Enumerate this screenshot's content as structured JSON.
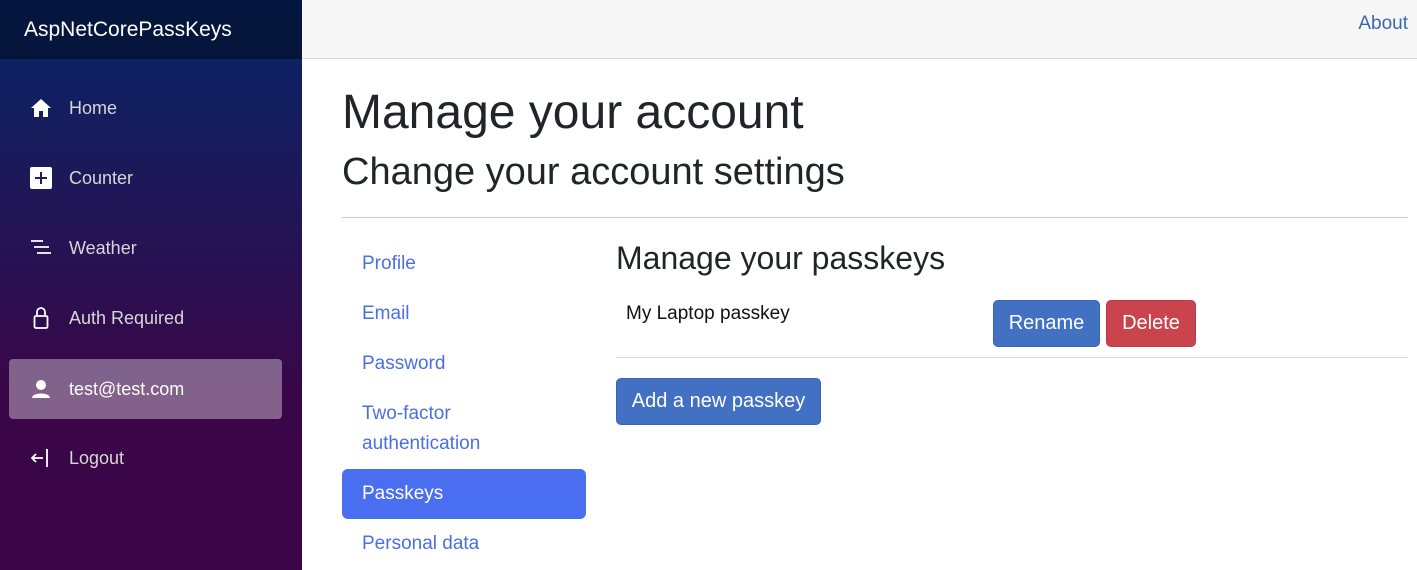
{
  "sidebar": {
    "brand": "AspNetCorePassKeys",
    "items": [
      {
        "label": "Home",
        "icon": "home-icon"
      },
      {
        "label": "Counter",
        "icon": "plus-square-icon"
      },
      {
        "label": "Weather",
        "icon": "list-icon"
      },
      {
        "label": "Auth Required",
        "icon": "lock-icon"
      },
      {
        "label": "test@test.com",
        "icon": "person-icon",
        "active": true
      },
      {
        "label": "Logout",
        "icon": "logout-icon"
      }
    ]
  },
  "topbar": {
    "about": "About"
  },
  "main": {
    "title": "Manage your account",
    "subtitle": "Change your account settings",
    "subnav": [
      {
        "label": "Profile"
      },
      {
        "label": "Email"
      },
      {
        "label": "Password"
      },
      {
        "label": "Two-factor authentication"
      },
      {
        "label": "Passkeys",
        "active": true
      },
      {
        "label": "Personal data"
      }
    ],
    "section_title": "Manage your passkeys",
    "passkeys": [
      {
        "name": "My Laptop passkey",
        "rename_label": "Rename",
        "delete_label": "Delete"
      }
    ],
    "add_label": "Add a new passkey"
  },
  "colors": {
    "accent": "#4a6ef0",
    "primary_button": "#4270c2",
    "danger_button": "#c9444d",
    "link": "#3868b4"
  }
}
